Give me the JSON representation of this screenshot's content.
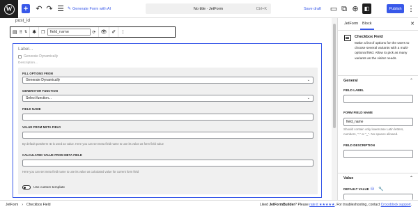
{
  "topbar": {
    "add_label": "+",
    "generate_ai_label": "Generate Form with AI",
    "doc_title": "No title · JetForm",
    "shortcut": "Ctrl+K",
    "save_draft_label": "Save draft",
    "publish_label": "Publish"
  },
  "canvas": {
    "post_text": "post_id",
    "toolbar": {
      "field_name_value": "field_name"
    },
    "block": {
      "label_placeholder": "Label...",
      "generate_dynamically_label": "Generate Dynamically",
      "description_placeholder": "Description...",
      "fields": [
        {
          "label": "FILL OPTIONS FROM",
          "value": "Generate Dynamically",
          "kind": "select"
        },
        {
          "label": "GENERATOR FUNCTION",
          "value": "Select function...",
          "kind": "select"
        },
        {
          "label": "FIELD NAME",
          "value": "",
          "kind": "input"
        },
        {
          "label": "VALUE FROM META FIELD",
          "value": "",
          "kind": "input",
          "help": "By default post/term ID is used as value. Here you can set meta field name to use its value as form field value"
        },
        {
          "label": "CALCULATED VALUE FROM META FIELD",
          "value": "",
          "kind": "input",
          "help": "Here you can set meta field name to use its value as calculated value for current form field"
        }
      ],
      "custom_template_label": "Use custom template"
    }
  },
  "sidebar": {
    "tabs": [
      "JetForm",
      "Block"
    ],
    "block_title": "Checkbox Field",
    "block_description": "Make a list of options for the users to choose several variants with a multi-optional field. Allow to pick as many variants as the visitor needs.",
    "general_label": "General",
    "field_label_label": "FIELD LABEL",
    "field_label_value": "",
    "form_field_name_label": "FORM FIELD NAME",
    "form_field_name_value": "field_name",
    "field_name_help": "Should contain only lowercase Latin letters, numbers, \"-\" or \"_\". No spaces allowed.",
    "field_description_label": "FIELD DESCRIPTION",
    "field_description_value": "",
    "value_label": "Value",
    "default_value_label": "DEFAULT VALUE"
  },
  "footer": {
    "breadcrumb": [
      "JetForm",
      "›",
      "Checkbox Field"
    ],
    "notice_pre": "Liked ",
    "notice_product": "JetFormBuilder",
    "notice_mid": "? Please ",
    "notice_rate": "rate it ★★★★★",
    "notice_post": ". For troubleshooting, contact ",
    "notice_support": "Crocoblock support",
    "notice_end": "."
  },
  "colors": {
    "accent": "#3858e9",
    "panel_bg": "#f0f0f0",
    "dark": "#1e1e1e"
  }
}
